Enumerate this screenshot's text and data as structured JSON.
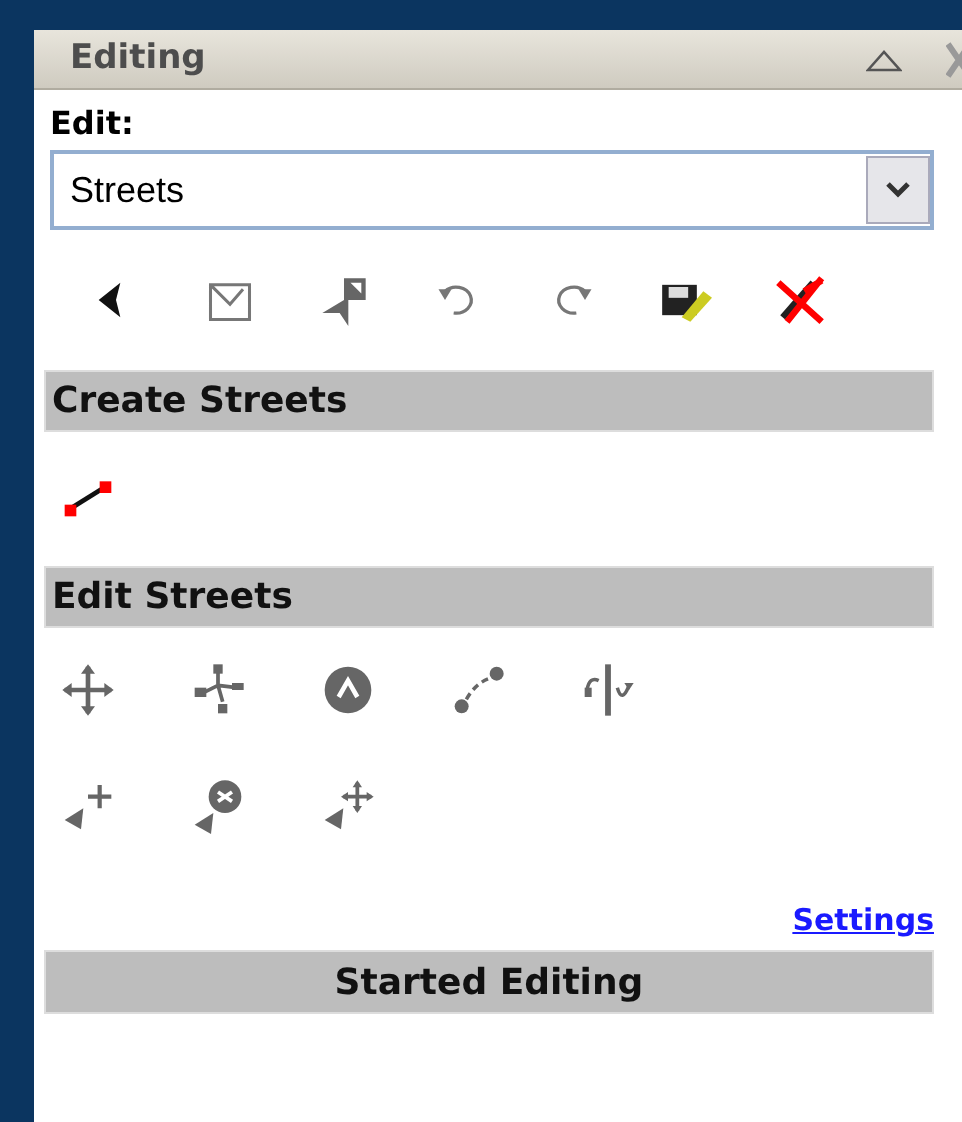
{
  "panel": {
    "title": "Editing"
  },
  "edit_label": "Edit:",
  "layer_select": {
    "value": "Streets"
  },
  "sections": [
    {
      "title": "Create Streets",
      "kind": "create"
    },
    {
      "title": "Edit Streets",
      "kind": "edit"
    }
  ],
  "settings_link": "Settings",
  "status_header": "Started Editing"
}
